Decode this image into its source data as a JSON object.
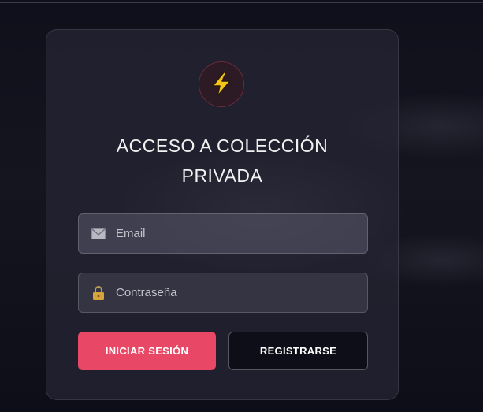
{
  "login": {
    "logo_icon": "lightning-bolt-icon",
    "title": "ACCESO A COLECCIÓN PRIVADA",
    "email": {
      "icon": "envelope-icon",
      "placeholder": "Email",
      "value": ""
    },
    "password": {
      "icon": "lock-icon",
      "placeholder": "Contraseña",
      "value": ""
    },
    "login_button": "INICIAR SESIÓN",
    "register_button": "REGISTRARSE"
  },
  "colors": {
    "accent": "#e84866",
    "logo_bolt": "#f5c518",
    "logo_ring": "#6a2a3c",
    "card_bg": "#26263a"
  }
}
